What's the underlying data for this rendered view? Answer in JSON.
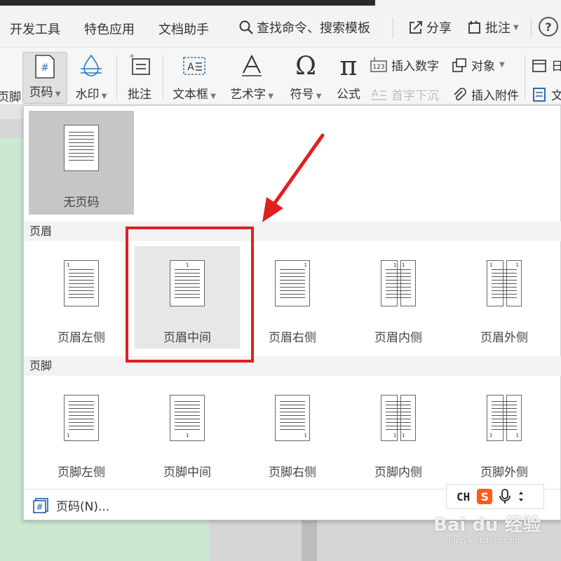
{
  "menubar": {
    "items": [
      "开发工具",
      "特色应用",
      "文档助手"
    ],
    "search": "查找命令、搜索模板",
    "share": "分享",
    "comment": "批注",
    "help": "?"
  },
  "ribbon": {
    "footer_partial": "页脚",
    "page_number": "页码",
    "watermark": "水印",
    "comment": "批注",
    "textbox": "文本框",
    "wordart": "艺术字",
    "symbol": "符号",
    "formula": "公式",
    "insert_number": "插入数字",
    "object": "对象",
    "dropcap": "首字下沉",
    "attachment": "插入附件",
    "date_partial": "日",
    "doc_partial": "文"
  },
  "dropdown": {
    "none_label": "无页码",
    "header_section": "页眉",
    "header_options": [
      "页眉左侧",
      "页眉中间",
      "页眉右侧",
      "页眉内侧",
      "页眉外侧"
    ],
    "footer_section": "页脚",
    "footer_options": [
      "页脚左侧",
      "页脚中间",
      "页脚右侧",
      "页脚内侧",
      "页脚外侧"
    ],
    "footer_button": "页码(N)...",
    "thumb_number": "1",
    "hovered": "页眉中间"
  },
  "ime": {
    "lang": "CH",
    "logo": "S"
  },
  "watermark": {
    "brand": "Bai du 经验",
    "url": "jingyan.baidu.com"
  },
  "colors": {
    "highlight": "#e02020",
    "hover": "#e7e7e7",
    "selected": "#c6c6c6",
    "accent": "#2b79c2"
  }
}
